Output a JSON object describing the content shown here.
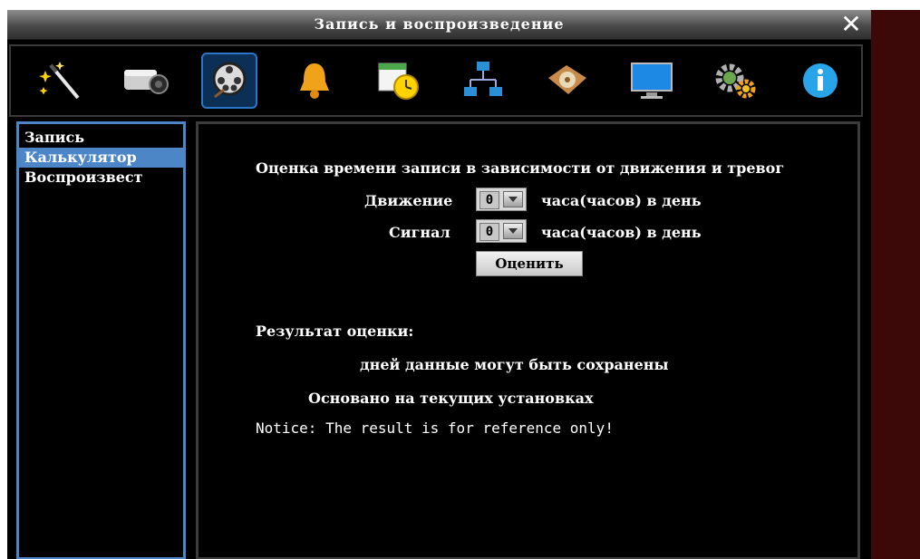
{
  "window": {
    "title": "Запись и воспроизведение"
  },
  "toolbar": {
    "icons": [
      "wizard-icon",
      "camera-icon",
      "record-playback-icon",
      "alarm-bell-icon",
      "schedule-icon",
      "network-icon",
      "disk-icon",
      "display-icon",
      "settings-icon",
      "info-icon"
    ],
    "active": "record-playback-icon"
  },
  "sidebar": {
    "items": [
      {
        "label": "Запись"
      },
      {
        "label": "Калькулятор"
      },
      {
        "label": "Воспроизвест"
      }
    ],
    "selected": "Калькулятор"
  },
  "calculator": {
    "heading": "Оценка времени записи в зависимости от движения и тревог",
    "motion_label": "Движение",
    "motion_value": "0",
    "alarm_label": "Сигнал",
    "alarm_value": "0",
    "unit_label": "часа(часов) в день",
    "estimate_button": "Оценить",
    "result_label": "Результат оценки:",
    "result_days": "дней данные могут быть сохранены",
    "based_on": "Основано на текущих установках",
    "notice": "Notice: The result is for reference only!"
  },
  "colors": {
    "accent": "#4c86c6",
    "background": "#000000",
    "side_strip": "#3d0808"
  }
}
